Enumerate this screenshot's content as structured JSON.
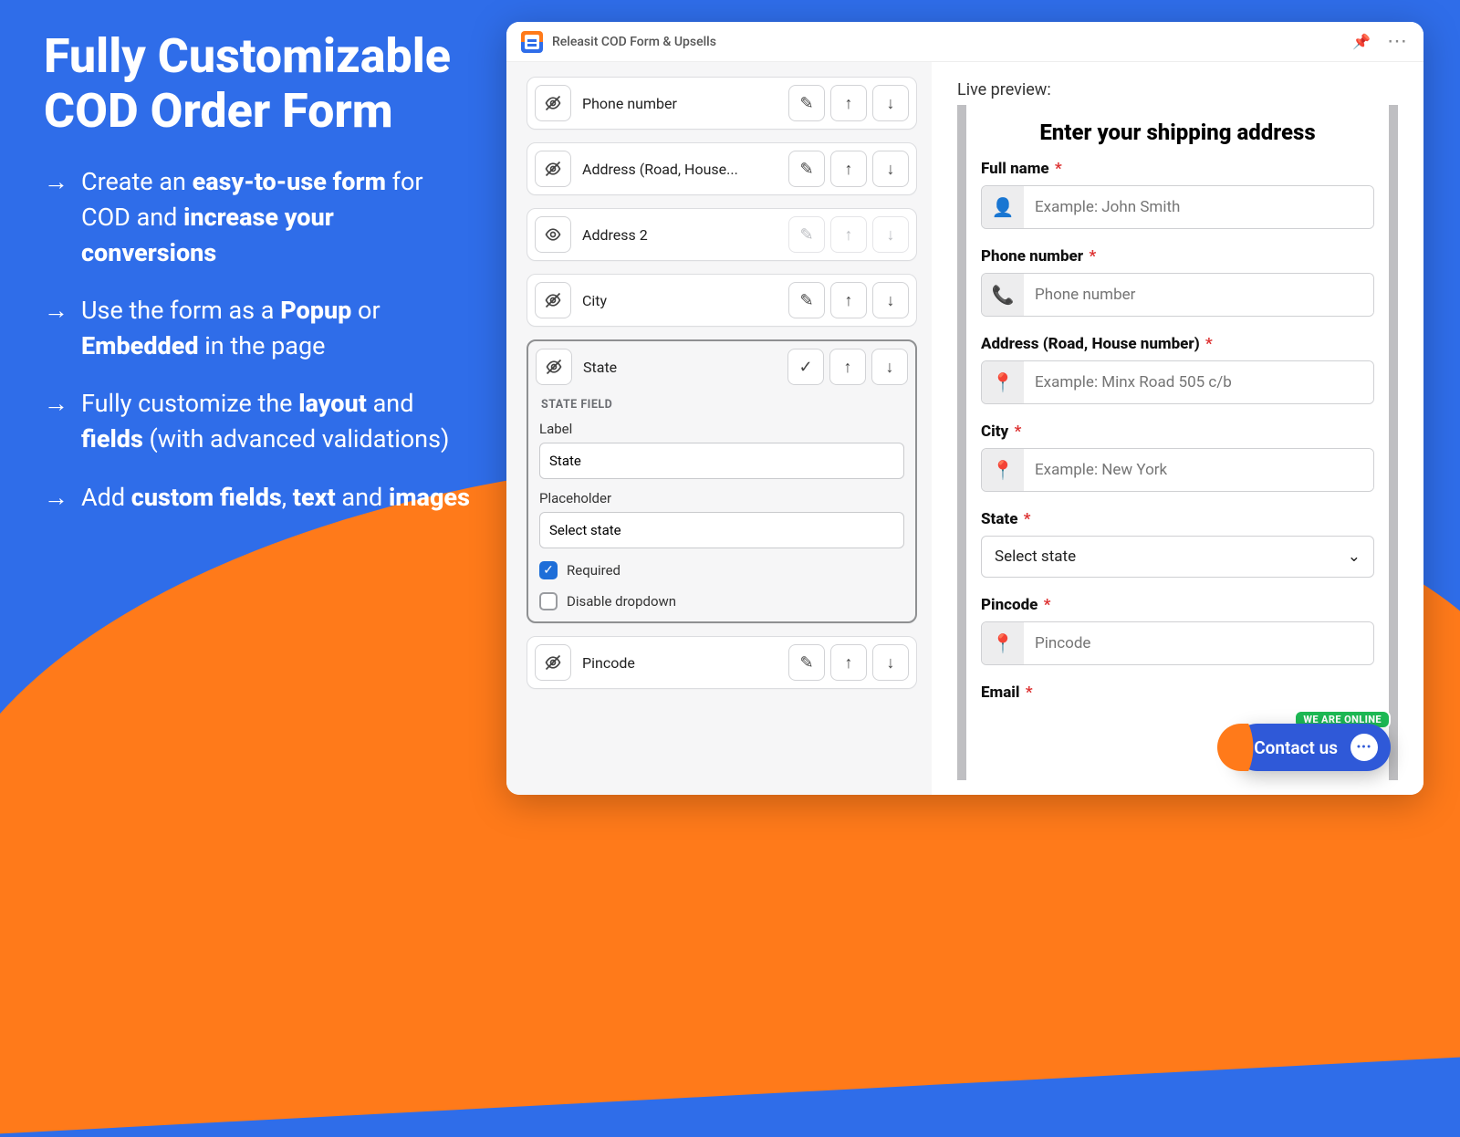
{
  "promo": {
    "title": "Fully Customizable COD Order Form",
    "bullets": [
      {
        "pre": "Create an ",
        "b1": "easy-to-use form",
        "mid": " for COD and ",
        "b2": "increase your conversions",
        "post": ""
      },
      {
        "pre": "Use the form as a ",
        "b1": "Popup",
        "mid": " or ",
        "b2": "Embedded",
        "post": " in the page"
      },
      {
        "pre": "Fully customize the ",
        "b1": "layout",
        "mid": " and ",
        "b2": "fields",
        "post": " (with advanced validations)"
      },
      {
        "pre": "Add ",
        "b1": "custom fields",
        "mid": ", ",
        "b2": "text",
        "post": " and ",
        "b3": "images"
      }
    ]
  },
  "app": {
    "title": "Releasit COD Form & Upsells"
  },
  "builder": {
    "rows": [
      {
        "label": "Phone number",
        "hidden": true,
        "dim": false
      },
      {
        "label": "Address (Road, House...",
        "hidden": true,
        "dim": false
      },
      {
        "label": "Address 2",
        "hidden": false,
        "dim": true
      },
      {
        "label": "City",
        "hidden": true,
        "dim": false
      },
      {
        "label": "Pincode",
        "hidden": true,
        "dim": false
      }
    ],
    "expanded": {
      "title": "STATE FIELD",
      "row_label": "State",
      "label_caption": "Label",
      "label_value": "State",
      "placeholder_caption": "Placeholder",
      "placeholder_value": "Select state",
      "required_label": "Required",
      "required": true,
      "disable_label": "Disable dropdown",
      "disable": false
    }
  },
  "preview": {
    "heading": "Live preview:",
    "title": "Enter your shipping address",
    "fields": {
      "fullname": {
        "label": "Full name",
        "ph": "Example: John Smith"
      },
      "phone": {
        "label": "Phone number",
        "ph": "Phone number"
      },
      "address": {
        "label": "Address (Road, House number)",
        "ph": "Example: Minx Road 505 c/b"
      },
      "city": {
        "label": "City",
        "ph": "Example: New York"
      },
      "state": {
        "label": "State",
        "value": "Select state"
      },
      "pincode": {
        "label": "Pincode",
        "ph": "Pincode"
      },
      "email": {
        "label": "Email"
      }
    }
  },
  "contact": {
    "text": "Contact us",
    "badge": "WE ARE ONLINE"
  }
}
